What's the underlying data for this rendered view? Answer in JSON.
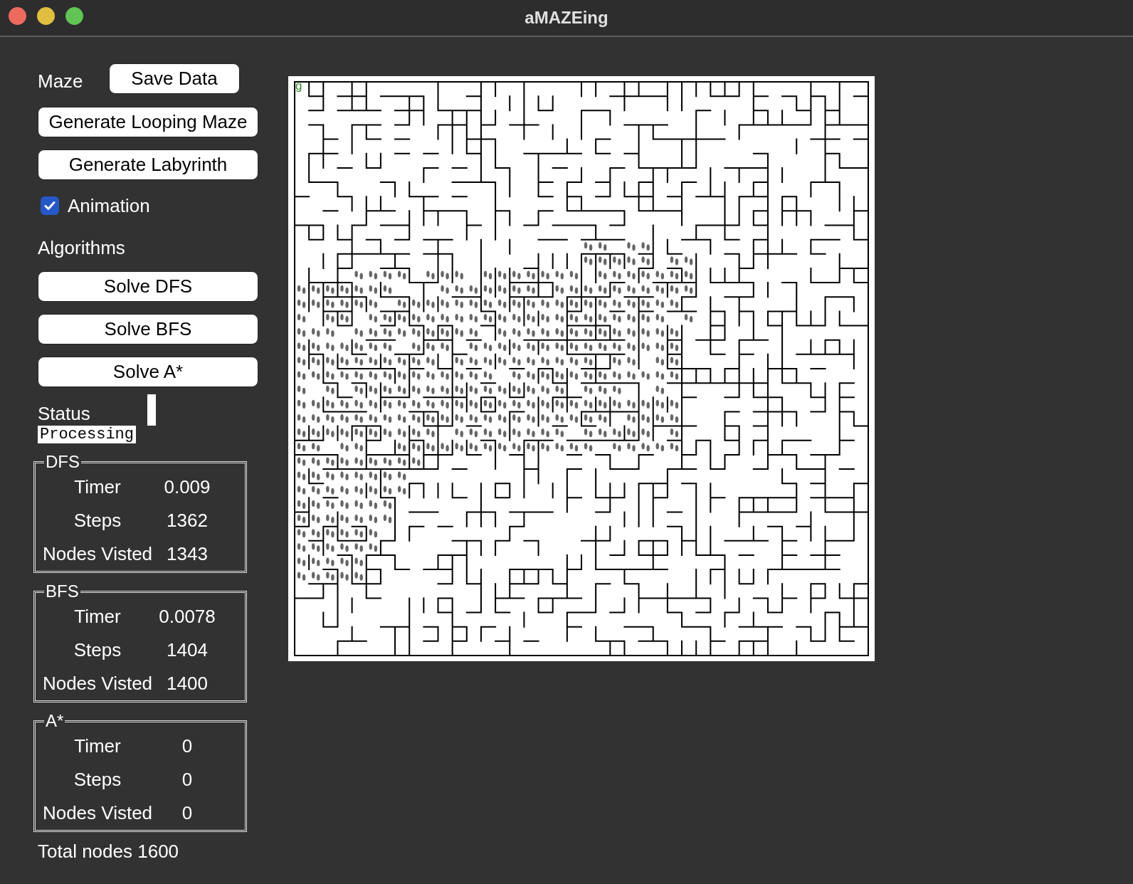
{
  "window": {
    "title": "aMAZEing"
  },
  "maze_section": {
    "label": "Maze",
    "save_button": "Save Data",
    "buttons": [
      "Generate Looping Maze",
      "Generate Labyrinth"
    ]
  },
  "animation": {
    "label": "Animation",
    "checked": true
  },
  "algorithms": {
    "label": "Algorithms",
    "buttons": [
      "Solve DFS",
      "Solve BFS",
      "Solve A*"
    ]
  },
  "status": {
    "label": "Status",
    "value": "Processing"
  },
  "results": [
    {
      "title": "DFS",
      "rows": [
        {
          "label": "Timer",
          "value": "0.009"
        },
        {
          "label": "Steps",
          "value": "1362"
        },
        {
          "label": "Nodes Visted",
          "value": "1343"
        }
      ]
    },
    {
      "title": "BFS",
      "rows": [
        {
          "label": "Timer",
          "value": "0.0078"
        },
        {
          "label": "Steps",
          "value": "1404"
        },
        {
          "label": "Nodes Visted",
          "value": "1400"
        }
      ]
    },
    {
      "title": "A*",
      "rows": [
        {
          "label": "Timer",
          "value": "0"
        },
        {
          "label": "Steps",
          "value": "0"
        },
        {
          "label": "Nodes Visted",
          "value": "0"
        }
      ]
    }
  ],
  "total_nodes": "Total nodes 1600",
  "maze": {
    "goal_marker": "g"
  }
}
